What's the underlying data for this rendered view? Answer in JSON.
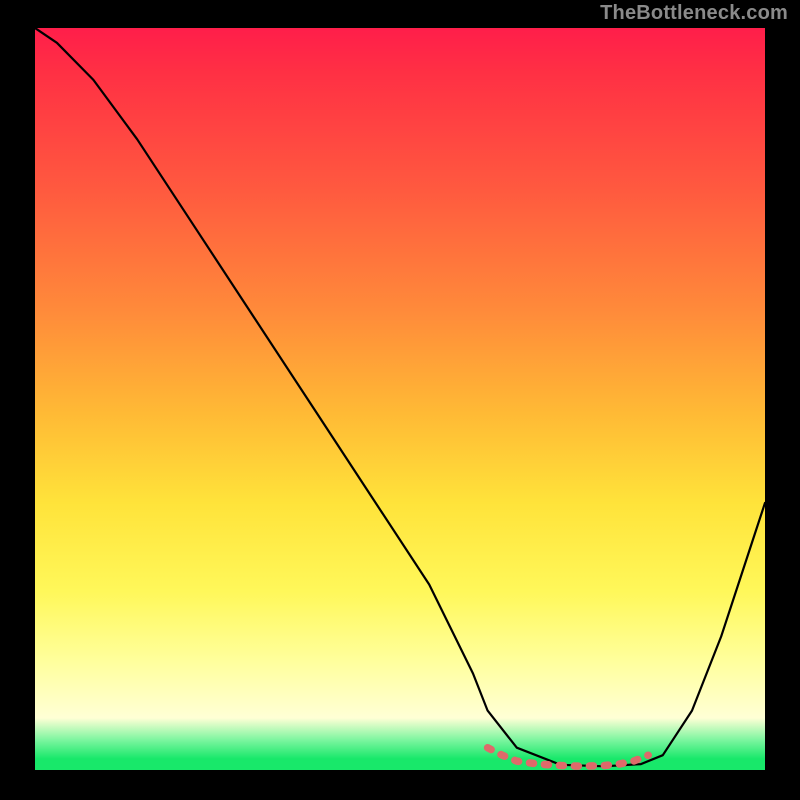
{
  "watermark": "TheBottleneck.com",
  "chart_data": {
    "type": "line",
    "title": "",
    "xlabel": "",
    "ylabel": "",
    "xlim": [
      0,
      100
    ],
    "ylim": [
      0,
      100
    ],
    "grid": false,
    "legend": false,
    "series": [
      {
        "name": "bottleneck-curve",
        "color": "#000000",
        "x": [
          0,
          3,
          8,
          14,
          22,
          30,
          38,
          46,
          54,
          60,
          62,
          66,
          72,
          78,
          83,
          86,
          90,
          94,
          98,
          100
        ],
        "values": [
          100,
          98,
          93,
          85,
          73,
          61,
          49,
          37,
          25,
          13,
          8,
          3,
          0.7,
          0.5,
          0.8,
          2,
          8,
          18,
          30,
          36
        ]
      },
      {
        "name": "optimal-segment",
        "color": "#de6a6a",
        "x": [
          62,
          64,
          66,
          69,
          72,
          75,
          78,
          80,
          82,
          84
        ],
        "values": [
          3,
          2,
          1.2,
          0.8,
          0.6,
          0.5,
          0.6,
          0.8,
          1.2,
          2
        ]
      }
    ],
    "background_gradient_stops": [
      {
        "pos": 0,
        "color": "#ff1e4a"
      },
      {
        "pos": 22,
        "color": "#ff5a3f"
      },
      {
        "pos": 52,
        "color": "#ffba35"
      },
      {
        "pos": 76,
        "color": "#fff85a"
      },
      {
        "pos": 93,
        "color": "#ffffd5"
      },
      {
        "pos": 98,
        "color": "#18e86a"
      }
    ]
  }
}
